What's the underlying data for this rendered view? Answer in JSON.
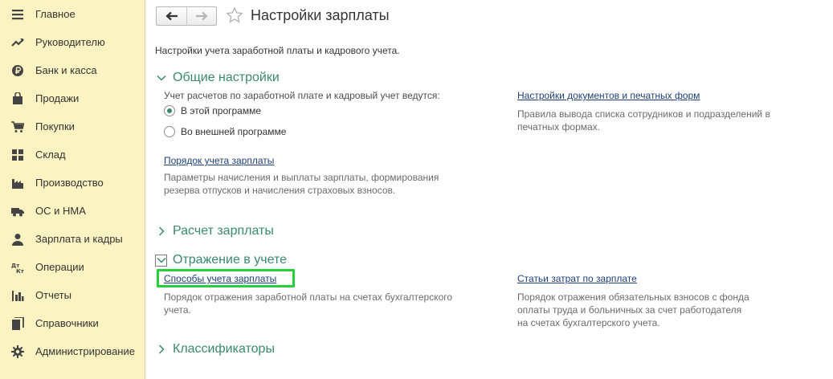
{
  "sidebar": {
    "items": [
      {
        "label": "Главное",
        "icon": "menu-icon"
      },
      {
        "label": "Руководителю",
        "icon": "trend-icon"
      },
      {
        "label": "Банк и касса",
        "icon": "ruble-icon"
      },
      {
        "label": "Продажи",
        "icon": "bag-icon"
      },
      {
        "label": "Покупки",
        "icon": "cart-icon"
      },
      {
        "label": "Склад",
        "icon": "grid-icon"
      },
      {
        "label": "Производство",
        "icon": "factory-icon"
      },
      {
        "label": "ОС и НМА",
        "icon": "truck-icon"
      },
      {
        "label": "Зарплата и кадры",
        "icon": "person-icon"
      },
      {
        "label": "Операции",
        "icon": "dt-kt-icon"
      },
      {
        "label": "Отчеты",
        "icon": "bar-chart-icon"
      },
      {
        "label": "Справочники",
        "icon": "book-icon"
      },
      {
        "label": "Администрирование",
        "icon": "gear-icon"
      }
    ]
  },
  "header": {
    "title": "Настройки зарплаты"
  },
  "description": "Настройки учета заработной платы и кадрового учета.",
  "general": {
    "title": "Общие настройки",
    "question": "Учет расчетов по заработной плате и кадровый учет ведутся:",
    "options": [
      "В этой программе",
      "Во внешней программе"
    ],
    "selected": "В этой программе",
    "payroll_link": "Порядок учета зарплаты",
    "payroll_hint": "Параметры начисления и выплаты зарплаты, формирования резерва отпусков и начисления страховых взносов.",
    "docs_link": "Настройки документов и печатных форм",
    "docs_hint": "Правила вывода списка сотрудников и подразделений в печатных формах."
  },
  "calc": {
    "title": "Расчет зарплаты"
  },
  "accounting": {
    "title": "Отражение в учете",
    "methods_link": "Способы учета зарплаты",
    "methods_hint": "Порядок отражения заработной платы на счетах бухгалтерского учета.",
    "costs_link": "Статьи затрат по зарплате",
    "costs_hint": "Порядок отражения обязательных взносов с фонда оплаты труда и больничных за счет работодателя на счетах бухгалтерского учета."
  },
  "classifiers": {
    "title": "Классификаторы"
  },
  "colors": {
    "sidebar_bg": "#fbf3c1",
    "accent": "#3a8a6c",
    "link": "#1d3f7a",
    "highlight": "#27d03a"
  }
}
